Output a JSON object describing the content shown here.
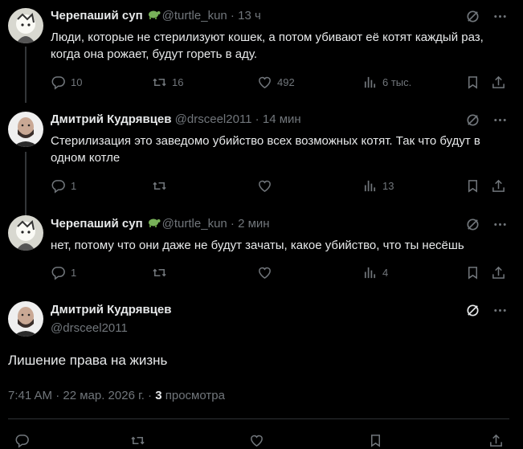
{
  "tweets": [
    {
      "name": "Черепаший суп",
      "handle": "@turtle_kun",
      "time": "13 ч",
      "text": "Люди, которые не стерилизуют кошек, а потом убивают её котят каждый раз, когда она рожает, будут гореть в аду.",
      "replies": "10",
      "retweets": "16",
      "likes": "492",
      "views": "6 тыс."
    },
    {
      "name": "Дмитрий Кудрявцев",
      "handle": "@drsceel2011",
      "time": "14 мин",
      "text": "Стерилизация это заведомо убийство всех возможных котят. Так что будут в одном котле",
      "replies": "1",
      "views": "13"
    },
    {
      "name": "Черепаший суп",
      "handle": "@turtle_kun",
      "time": "2 мин",
      "text": "нет, потому что они даже не будут зачаты, какое убийство, что ты несёшь",
      "replies": "1",
      "views": "4"
    }
  ],
  "focused": {
    "name": "Дмитрий Кудрявцев",
    "handle": "@drsceel2011",
    "text": "Лишение права на жизнь",
    "timestamp": "7:41 AM · 22 мар. 2026 г. · ",
    "views_count": "3",
    "views_label": " просмотра"
  },
  "separator": " · ",
  "colors": {
    "background": "#000000",
    "text": "#e7e9ea",
    "muted": "#71767b",
    "divider": "#2f3336"
  }
}
